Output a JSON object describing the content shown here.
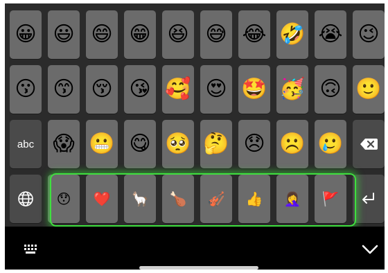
{
  "keyboard": {
    "abc_label": "abc",
    "row1": [
      "😀",
      "😃",
      "😄",
      "😁",
      "😆",
      "😅",
      "😂",
      "🤣",
      "😭",
      "😉"
    ],
    "row2": [
      "😗",
      "😙",
      "😚",
      "😘",
      "🥰",
      "😍",
      "🤩",
      "🥳",
      "🙃",
      "🙂"
    ],
    "row3": [
      "😱",
      "😬",
      "😋",
      "🥺",
      "🤔",
      "😞",
      "☹️",
      "🥲"
    ],
    "suggestions": [
      "😯",
      "❤️",
      "🦙",
      "🍗",
      "🎻",
      "👍",
      "🤦‍♀️",
      "🚩"
    ]
  },
  "icons": {
    "globe": "globe-icon",
    "backspace": "backspace-icon",
    "return": "return-icon",
    "keyboard": "keyboard-icon",
    "dismiss": "chevron-down-icon"
  },
  "colors": {
    "suggestion_highlight": "#3fe03f",
    "key_background": "#6b6b6b",
    "keyboard_background": "#2b2b2b"
  }
}
